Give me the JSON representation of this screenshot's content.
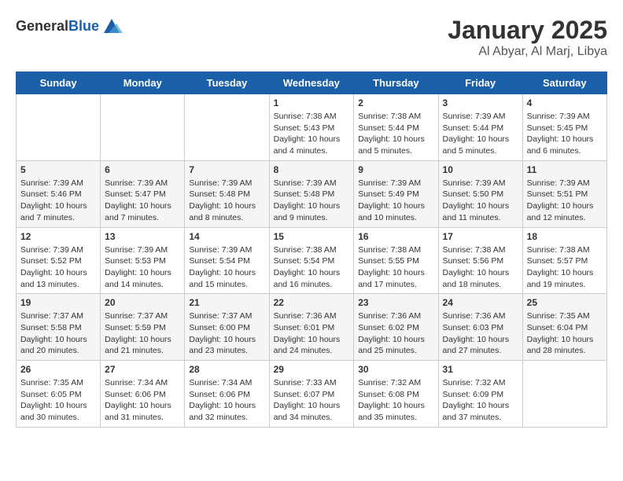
{
  "logo": {
    "general": "General",
    "blue": "Blue"
  },
  "title": "January 2025",
  "subtitle": "Al Abyar, Al Marj, Libya",
  "days_of_week": [
    "Sunday",
    "Monday",
    "Tuesday",
    "Wednesday",
    "Thursday",
    "Friday",
    "Saturday"
  ],
  "weeks": [
    [
      {
        "day": "",
        "details": ""
      },
      {
        "day": "",
        "details": ""
      },
      {
        "day": "",
        "details": ""
      },
      {
        "day": "1",
        "details": "Sunrise: 7:38 AM\nSunset: 5:43 PM\nDaylight: 10 hours\nand 4 minutes."
      },
      {
        "day": "2",
        "details": "Sunrise: 7:38 AM\nSunset: 5:44 PM\nDaylight: 10 hours\nand 5 minutes."
      },
      {
        "day": "3",
        "details": "Sunrise: 7:39 AM\nSunset: 5:44 PM\nDaylight: 10 hours\nand 5 minutes."
      },
      {
        "day": "4",
        "details": "Sunrise: 7:39 AM\nSunset: 5:45 PM\nDaylight: 10 hours\nand 6 minutes."
      }
    ],
    [
      {
        "day": "5",
        "details": "Sunrise: 7:39 AM\nSunset: 5:46 PM\nDaylight: 10 hours\nand 7 minutes."
      },
      {
        "day": "6",
        "details": "Sunrise: 7:39 AM\nSunset: 5:47 PM\nDaylight: 10 hours\nand 7 minutes."
      },
      {
        "day": "7",
        "details": "Sunrise: 7:39 AM\nSunset: 5:48 PM\nDaylight: 10 hours\nand 8 minutes."
      },
      {
        "day": "8",
        "details": "Sunrise: 7:39 AM\nSunset: 5:48 PM\nDaylight: 10 hours\nand 9 minutes."
      },
      {
        "day": "9",
        "details": "Sunrise: 7:39 AM\nSunset: 5:49 PM\nDaylight: 10 hours\nand 10 minutes."
      },
      {
        "day": "10",
        "details": "Sunrise: 7:39 AM\nSunset: 5:50 PM\nDaylight: 10 hours\nand 11 minutes."
      },
      {
        "day": "11",
        "details": "Sunrise: 7:39 AM\nSunset: 5:51 PM\nDaylight: 10 hours\nand 12 minutes."
      }
    ],
    [
      {
        "day": "12",
        "details": "Sunrise: 7:39 AM\nSunset: 5:52 PM\nDaylight: 10 hours\nand 13 minutes."
      },
      {
        "day": "13",
        "details": "Sunrise: 7:39 AM\nSunset: 5:53 PM\nDaylight: 10 hours\nand 14 minutes."
      },
      {
        "day": "14",
        "details": "Sunrise: 7:39 AM\nSunset: 5:54 PM\nDaylight: 10 hours\nand 15 minutes."
      },
      {
        "day": "15",
        "details": "Sunrise: 7:38 AM\nSunset: 5:54 PM\nDaylight: 10 hours\nand 16 minutes."
      },
      {
        "day": "16",
        "details": "Sunrise: 7:38 AM\nSunset: 5:55 PM\nDaylight: 10 hours\nand 17 minutes."
      },
      {
        "day": "17",
        "details": "Sunrise: 7:38 AM\nSunset: 5:56 PM\nDaylight: 10 hours\nand 18 minutes."
      },
      {
        "day": "18",
        "details": "Sunrise: 7:38 AM\nSunset: 5:57 PM\nDaylight: 10 hours\nand 19 minutes."
      }
    ],
    [
      {
        "day": "19",
        "details": "Sunrise: 7:37 AM\nSunset: 5:58 PM\nDaylight: 10 hours\nand 20 minutes."
      },
      {
        "day": "20",
        "details": "Sunrise: 7:37 AM\nSunset: 5:59 PM\nDaylight: 10 hours\nand 21 minutes."
      },
      {
        "day": "21",
        "details": "Sunrise: 7:37 AM\nSunset: 6:00 PM\nDaylight: 10 hours\nand 23 minutes."
      },
      {
        "day": "22",
        "details": "Sunrise: 7:36 AM\nSunset: 6:01 PM\nDaylight: 10 hours\nand 24 minutes."
      },
      {
        "day": "23",
        "details": "Sunrise: 7:36 AM\nSunset: 6:02 PM\nDaylight: 10 hours\nand 25 minutes."
      },
      {
        "day": "24",
        "details": "Sunrise: 7:36 AM\nSunset: 6:03 PM\nDaylight: 10 hours\nand 27 minutes."
      },
      {
        "day": "25",
        "details": "Sunrise: 7:35 AM\nSunset: 6:04 PM\nDaylight: 10 hours\nand 28 minutes."
      }
    ],
    [
      {
        "day": "26",
        "details": "Sunrise: 7:35 AM\nSunset: 6:05 PM\nDaylight: 10 hours\nand 30 minutes."
      },
      {
        "day": "27",
        "details": "Sunrise: 7:34 AM\nSunset: 6:06 PM\nDaylight: 10 hours\nand 31 minutes."
      },
      {
        "day": "28",
        "details": "Sunrise: 7:34 AM\nSunset: 6:06 PM\nDaylight: 10 hours\nand 32 minutes."
      },
      {
        "day": "29",
        "details": "Sunrise: 7:33 AM\nSunset: 6:07 PM\nDaylight: 10 hours\nand 34 minutes."
      },
      {
        "day": "30",
        "details": "Sunrise: 7:32 AM\nSunset: 6:08 PM\nDaylight: 10 hours\nand 35 minutes."
      },
      {
        "day": "31",
        "details": "Sunrise: 7:32 AM\nSunset: 6:09 PM\nDaylight: 10 hours\nand 37 minutes."
      },
      {
        "day": "",
        "details": ""
      }
    ]
  ]
}
